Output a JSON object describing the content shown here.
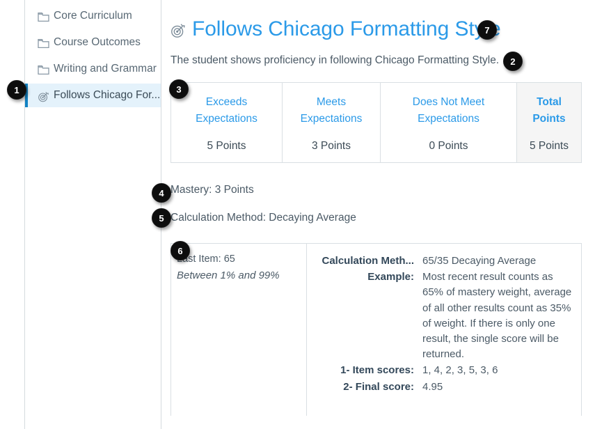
{
  "sidebar": {
    "items": [
      {
        "label": "Core Curriculum",
        "icon": "folder-icon",
        "selected": false
      },
      {
        "label": "Course Outcomes",
        "icon": "folder-icon",
        "selected": false
      },
      {
        "label": "Writing and Grammar",
        "icon": "folder-icon",
        "selected": false
      },
      {
        "label": "Follows Chicago For...",
        "icon": "outcome-target-icon",
        "selected": true
      }
    ]
  },
  "outcome": {
    "title": "Follows Chicago Formatting Style",
    "title_icon": "outcome-target-icon",
    "description": "The student shows proficiency in following Chicago Formatting Style.",
    "mastery": "Mastery: 3 Points",
    "calculation_method": "Calculation Method: Decaying Average"
  },
  "ratings": {
    "columns": [
      {
        "name": "Exceeds Expectations",
        "points": "5 Points",
        "total": false
      },
      {
        "name": "Meets Expectations",
        "points": "3 Points",
        "total": false
      },
      {
        "name": "Does Not Meet Expectations",
        "points": "0 Points",
        "total": false
      },
      {
        "name": "Total Points",
        "points": "5 Points",
        "total": true
      }
    ]
  },
  "calculation_card": {
    "left": {
      "last_item": "Last Item: 65",
      "range": "Between 1% and 99%"
    },
    "rows": [
      {
        "label": "Calculation Meth...",
        "value": "65/35 Decaying Average"
      },
      {
        "label": "Example:",
        "value": "Most recent result counts as 65% of mastery weight, average of all other results count as 35% of weight. If there is only one result, the single score will be returned."
      },
      {
        "label": "1- Item scores:",
        "value": "1, 4, 2, 3, 5, 3, 6"
      },
      {
        "label": "2- Final score:",
        "value": "4.95"
      }
    ]
  },
  "callouts": [
    {
      "number": "1"
    },
    {
      "number": "2"
    },
    {
      "number": "3"
    },
    {
      "number": "4"
    },
    {
      "number": "5"
    },
    {
      "number": "6"
    },
    {
      "number": "7"
    }
  ],
  "colors": {
    "link_blue": "#2b9ae8",
    "selected_bg": "#e4f2fb",
    "selected_border": "#1283c4",
    "total_bg": "#f5f5f5",
    "border_gray": "#d9dfe3",
    "badge_bg": "#0d0d0d"
  }
}
